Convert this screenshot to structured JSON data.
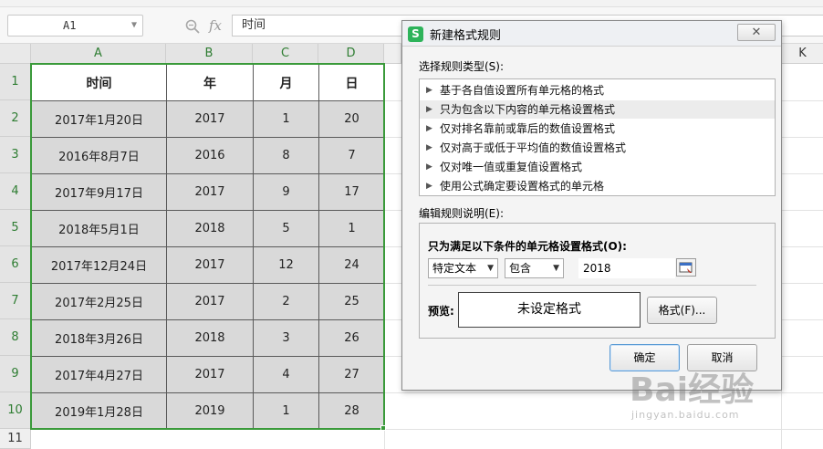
{
  "formula_bar": {
    "name_box": "A1",
    "fx_label": "fx",
    "formula_value": "时间"
  },
  "columns": [
    "A",
    "B",
    "C",
    "D"
  ],
  "far_column": "K",
  "rows": [
    "1",
    "2",
    "3",
    "4",
    "5",
    "6",
    "7",
    "8",
    "9",
    "10"
  ],
  "extra_row": "11",
  "table": {
    "header": [
      "时间",
      "年",
      "月",
      "日"
    ],
    "body": [
      [
        "2017年1月20日",
        "2017",
        "1",
        "20"
      ],
      [
        "2016年8月7日",
        "2016",
        "8",
        "7"
      ],
      [
        "2017年9月17日",
        "2017",
        "9",
        "17"
      ],
      [
        "2018年5月1日",
        "2018",
        "5",
        "1"
      ],
      [
        "2017年12月24日",
        "2017",
        "12",
        "24"
      ],
      [
        "2017年2月25日",
        "2017",
        "2",
        "25"
      ],
      [
        "2018年3月26日",
        "2018",
        "3",
        "26"
      ],
      [
        "2017年4月27日",
        "2017",
        "4",
        "27"
      ],
      [
        "2019年1月28日",
        "2019",
        "1",
        "28"
      ]
    ]
  },
  "dialog": {
    "app_logo": "S",
    "title": "新建格式规则",
    "close": "✕",
    "select_rule_type_label": "选择规则类型(S):",
    "rule_types": [
      "基于各自值设置所有单元格的格式",
      "只为包含以下内容的单元格设置格式",
      "仅对排名靠前或靠后的数值设置格式",
      "仅对高于或低于平均值的数值设置格式",
      "仅对唯一值或重复值设置格式",
      "使用公式确定要设置格式的单元格"
    ],
    "selected_rule_index": 1,
    "edit_rule_label": "编辑规则说明(E):",
    "condition_title": "只为满足以下条件的单元格设置格式(O):",
    "condition_type": "特定文本",
    "operator": "包含",
    "condition_value": "2018",
    "preview_label": "预览:",
    "preview_text": "未设定格式",
    "format_button": "格式(F)...",
    "ok_button": "确定",
    "cancel_button": "取消"
  },
  "watermark": {
    "text": "Bai经验",
    "sub": "jingyan.baidu.com"
  },
  "colors": {
    "selection_green": "#3a9a3a",
    "header_text_green": "#2e7d32",
    "cell_fill": "#d9d9d9",
    "wps_logo": "#2db35a"
  }
}
